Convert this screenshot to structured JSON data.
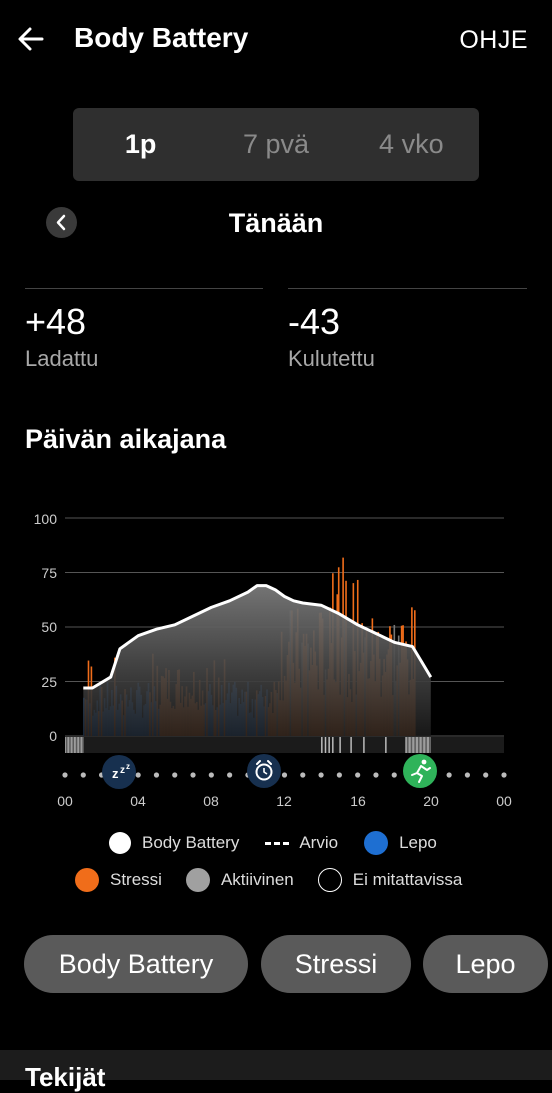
{
  "header": {
    "title": "Body Battery",
    "help_label": "OHJE"
  },
  "range_tabs": [
    {
      "label": "1p",
      "active": true
    },
    {
      "label": "7 pvä",
      "active": false
    },
    {
      "label": "4 vko",
      "active": false
    }
  ],
  "date": {
    "label": "Tänään"
  },
  "stats": {
    "charged": {
      "value": "+48",
      "label": "Ladattu"
    },
    "drained": {
      "value": "-43",
      "label": "Kulutettu"
    }
  },
  "timeline": {
    "title": "Päivän aikajana"
  },
  "chart_data": {
    "type": "area",
    "y_ticks": [
      "100",
      "75",
      "50",
      "25",
      "0"
    ],
    "x_ticks": [
      "00",
      "04",
      "08",
      "12",
      "16",
      "20",
      "00"
    ],
    "ylim": [
      0,
      100
    ],
    "xlim": [
      0,
      24
    ],
    "body_battery_series": {
      "name": "Body Battery",
      "x": [
        1.0,
        1.5,
        2.5,
        3.0,
        4.0,
        5.0,
        6.0,
        7.0,
        8.0,
        9.0,
        10.0,
        10.5,
        11.0,
        11.5,
        12.0,
        12.5,
        13.0,
        14.0,
        15.0,
        16.0,
        17.0,
        18.0,
        18.5,
        19.0,
        19.5,
        20.0
      ],
      "y": [
        22,
        22,
        27,
        40,
        46,
        49,
        51,
        55,
        59,
        62,
        66,
        69,
        69,
        67,
        64,
        62,
        61,
        60,
        56,
        51,
        47,
        43,
        42,
        41,
        34,
        27
      ]
    },
    "legend": [
      {
        "label": "Body Battery",
        "color": "#ffffff"
      },
      {
        "label": "Arvio",
        "color": "#ffffff"
      },
      {
        "label": "Lepo",
        "color": "#1e6fd2"
      },
      {
        "label": "Stressi",
        "color": "#f06d1a"
      },
      {
        "label": "Aktiivinen",
        "color": "#a0a0a0"
      },
      {
        "label": "Ei mitattavissa",
        "color": "#000000"
      }
    ],
    "event_icons": [
      {
        "name": "sleep-icon",
        "hour": 3
      },
      {
        "name": "alarm-icon",
        "hour": 11
      },
      {
        "name": "running-icon",
        "hour": 19
      }
    ],
    "colors": {
      "rest": "#1e6fd2",
      "stress": "#f06d1a",
      "grid": "#555555"
    }
  },
  "chips": [
    {
      "label": "Body Battery"
    },
    {
      "label": "Stressi"
    },
    {
      "label": "Lepo"
    }
  ],
  "footer": {
    "title": "Tekijät"
  }
}
